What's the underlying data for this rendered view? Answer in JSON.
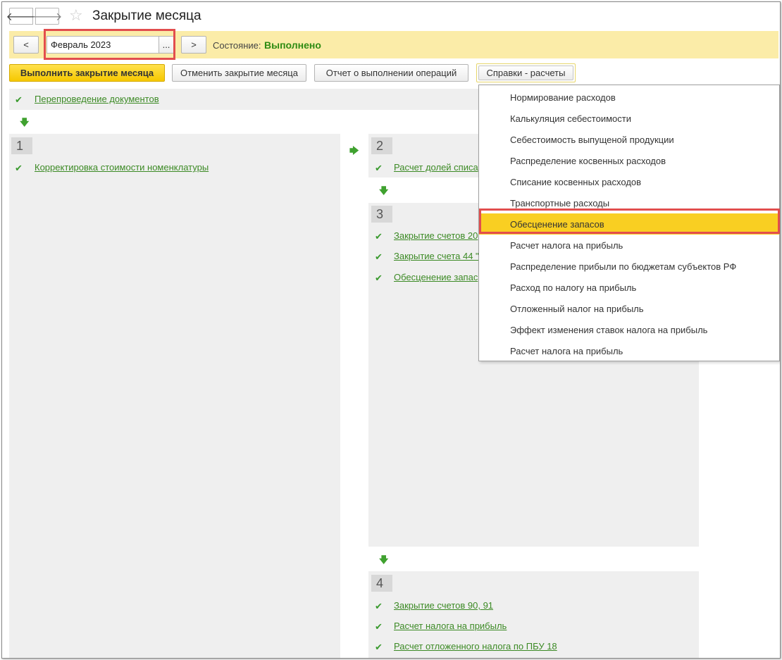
{
  "window": {
    "title": "Закрытие месяца"
  },
  "nav": {
    "back_glyph": "🡐",
    "forward_glyph": "🡒",
    "star_glyph": "☆"
  },
  "period": {
    "prev_label": "<",
    "next_label": ">",
    "value": "Февраль 2023",
    "choose_label": "...",
    "status_label": "Состояние:",
    "status_value": "Выполнено"
  },
  "toolbar": {
    "run_label": "Выполнить закрытие месяца",
    "cancel_label": "Отменить закрытие месяца",
    "report_label": "Отчет о выполнении операций",
    "reports_menu_label": "Справки - расчеты"
  },
  "steps": {
    "repost": "Перепроведение документов",
    "stage1": {
      "number": "1",
      "items": [
        "Корректировка стоимости номенклатуры"
      ]
    },
    "stage2": {
      "number": "2",
      "items": [
        "Расчет долей списа"
      ]
    },
    "stage3": {
      "number": "3",
      "items": [
        "Закрытие счетов 20",
        "Закрытие счета 44 \"",
        "Обесценение запас"
      ]
    },
    "stage4": {
      "number": "4",
      "items": [
        "Закрытие счетов 90, 91",
        "Расчет налога на прибыль",
        "Расчет отложенного налога по ПБУ 18"
      ]
    }
  },
  "dropdown": {
    "items": [
      "Нормирование расходов",
      "Калькуляция себестоимости",
      "Себестоимость выпущеной продукции",
      "Распределение косвенных расходов",
      "Списание косвенных расходов",
      "Транспортные расходы",
      "Обесценение запасов",
      "Расчет налога на прибыль",
      "Распределение прибыли по бюджетам субъектов РФ",
      "Расход по налогу на прибыль",
      "Отложенный налог на прибыль",
      "Эффект изменения ставок налога на прибыль",
      "Расчет налога на прибыль"
    ],
    "selected_index": 6
  },
  "colors": {
    "accent_yellow": "#f9cf22",
    "link_green": "#3c8a25",
    "status_green": "#2e8b12",
    "highlight_red": "#e24e4e"
  }
}
